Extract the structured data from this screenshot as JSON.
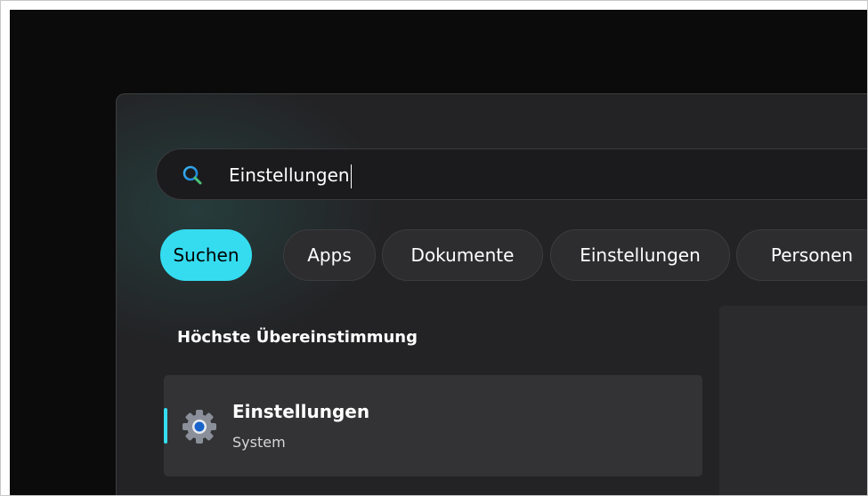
{
  "search": {
    "query": "Einstellungen"
  },
  "filters": [
    {
      "label": "Suchen",
      "active": true
    },
    {
      "label": "Apps",
      "active": false
    },
    {
      "label": "Dokumente",
      "active": false
    },
    {
      "label": "Einstellungen",
      "active": false
    },
    {
      "label": "Personen",
      "active": false
    }
  ],
  "best_match": {
    "heading": "Höchste Übereinstimmung",
    "item": {
      "title": "Einstellungen",
      "subtitle": "System",
      "icon": "gear-icon"
    }
  },
  "colors": {
    "accent": "#35dcf0",
    "panel": "#232325",
    "desktop": "#0b0b0c"
  }
}
